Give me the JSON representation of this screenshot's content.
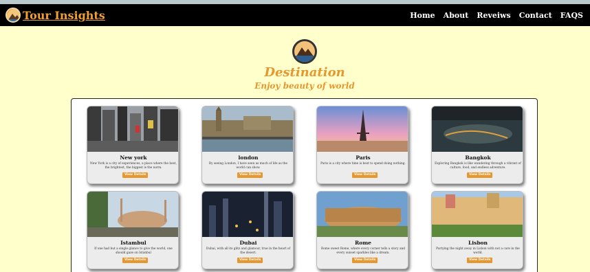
{
  "brand": {
    "name": "Tour Insights",
    "logo_icon": "mountain-logo-icon"
  },
  "nav": {
    "items": [
      {
        "label": "Home"
      },
      {
        "label": "About"
      },
      {
        "label": "Reveiws"
      },
      {
        "label": "Contact"
      },
      {
        "label": "FAQS"
      }
    ]
  },
  "hero": {
    "logo_icon": "mountain-logo-icon",
    "title": "Destination",
    "subtitle": "Enjoy beauty of world"
  },
  "cards": [
    {
      "title": "New york",
      "desc": "New York is a city of experiences, a place where the best, the brightest, the biggest is the norm.",
      "button": "View Details",
      "image_icon": "new-york-photo"
    },
    {
      "title": "london",
      "desc": "By seeing London, I have seen as much of life as the world can show.",
      "button": "View Details",
      "image_icon": "london-photo"
    },
    {
      "title": "Paris",
      "desc": "Paris is a city where time is best to spend doing nothing.",
      "button": "View Details",
      "image_icon": "paris-photo"
    },
    {
      "title": "Bangkok",
      "desc": "Exploring Bangkok is like wandering through a vibrant of culture, food, and endless adventure.",
      "button": "View Details",
      "image_icon": "bangkok-photo"
    },
    {
      "title": "Istambul",
      "desc": "If one had but a single glance to give the world, one should gaze on Istanbul",
      "button": "View Details",
      "image_icon": "istanbul-photo"
    },
    {
      "title": "Dubai",
      "desc": "Dubai, with all its glitz and glamour, true in the heart of the desert.",
      "button": "View Details",
      "image_icon": "dubai-photo"
    },
    {
      "title": "Rome",
      "desc": "Rome sweet Rome, where every corner tells a story and every sunset sparkles like a dream.",
      "button": "View Details",
      "image_icon": "rome-photo"
    },
    {
      "title": "Lisbon",
      "desc": "Partying the night away in Lisbon with not a care in the world.",
      "button": "View Details",
      "image_icon": "lisbon-photo"
    }
  ],
  "colors": {
    "accent": "#e8962e",
    "navbar": "#000000",
    "page_bg": "#ffffcc"
  }
}
